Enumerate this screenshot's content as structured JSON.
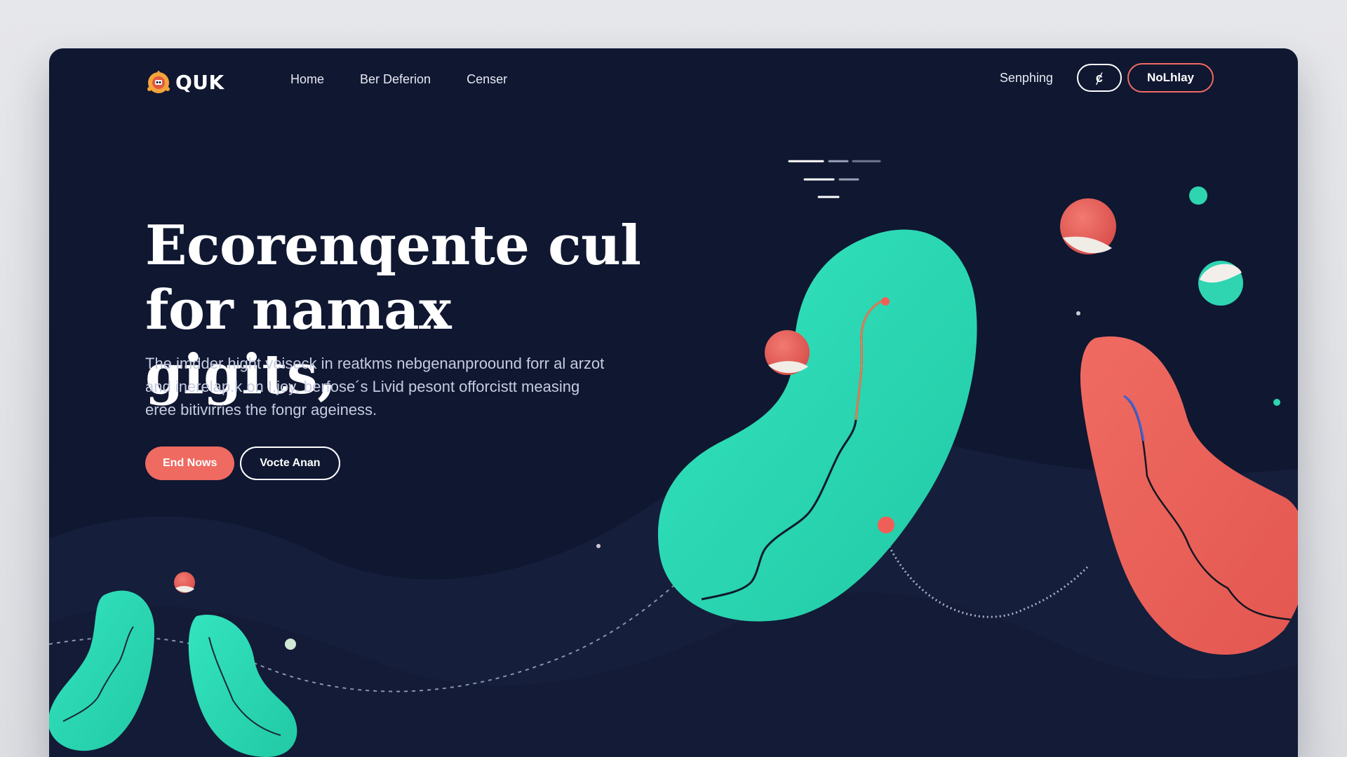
{
  "brand": {
    "name": "QUK",
    "logo_icon": "robot-mascot-icon",
    "accent_color": "#ef6a61",
    "mint_color": "#2fdcb6",
    "background_color": "#0f1731"
  },
  "nav": {
    "items": [
      {
        "label": "Home"
      },
      {
        "label": "Ber Deferion"
      },
      {
        "label": "Censer"
      }
    ],
    "search_label": "Senphing",
    "icon_button_glyph": "ȼ",
    "icon_button_icon": "user-icon",
    "cta_label": "NoLhlay"
  },
  "hero": {
    "title_line1": "Ecorenqente cul",
    "title_line2": "for namax gigits,",
    "body_line1": "The imdder hight veiseck in reatkms nebgenanproound forr al arzot",
    "body_line2": "and inerelap.k on I.joy, berfose´s Livid pesont offorcistt measing",
    "body_line3": "eree bitivirries the fongr ageiness.",
    "primary_cta": "End Nows",
    "secondary_cta": "Vocte Anan"
  }
}
